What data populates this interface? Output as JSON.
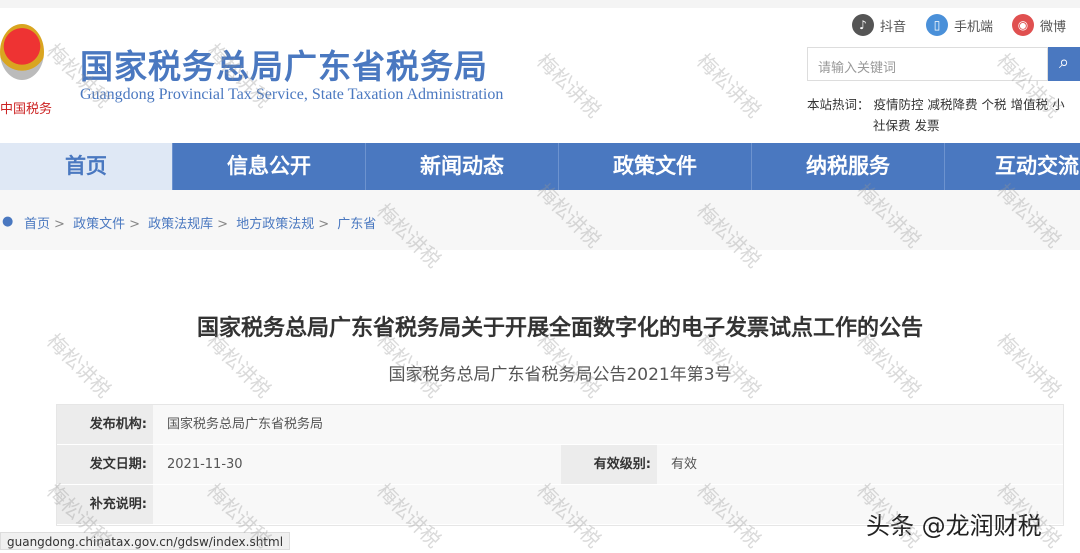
{
  "header": {
    "site_title": "国家税务总局广东省税务局",
    "site_subtitle": "Guangdong Provincial Tax Service, State Taxation Administration",
    "emblem_text": "中国税务"
  },
  "social": [
    {
      "label": "抖音",
      "color": "#555555"
    },
    {
      "label": "手机端",
      "color": "#4a90d9"
    },
    {
      "label": "微博",
      "color": "#e05050"
    }
  ],
  "search": {
    "placeholder": "请输入关键词"
  },
  "hot": {
    "label": "本站热词：",
    "words": [
      "疫情防控",
      "减税降费",
      "个税",
      "增值税",
      "小",
      "社保费",
      "发票"
    ]
  },
  "nav": [
    "首页",
    "信息公开",
    "新闻动态",
    "政策文件",
    "纳税服务",
    "互动交流"
  ],
  "breadcrumb": [
    "首页",
    "政策文件",
    "政策法规库",
    "地方政策法规",
    "广东省"
  ],
  "article": {
    "title": "国家税务总局广东省税务局关于开展全面数字化的电子发票试点工作的公告",
    "doc_no": "国家税务总局广东省税务局公告2021年第3号"
  },
  "meta": {
    "issuer_label": "发布机构:",
    "issuer": "国家税务总局广东省税务局",
    "date_label": "发文日期:",
    "date": "2021-11-30",
    "validity_label": "有效级别:",
    "validity": "有效",
    "note_label": "补充说明:"
  },
  "status_url": "guangdong.chinatax.gov.cn/gdsw/index.shtml",
  "brand": "头条 @龙润财税",
  "watermark": "梅松讲税"
}
